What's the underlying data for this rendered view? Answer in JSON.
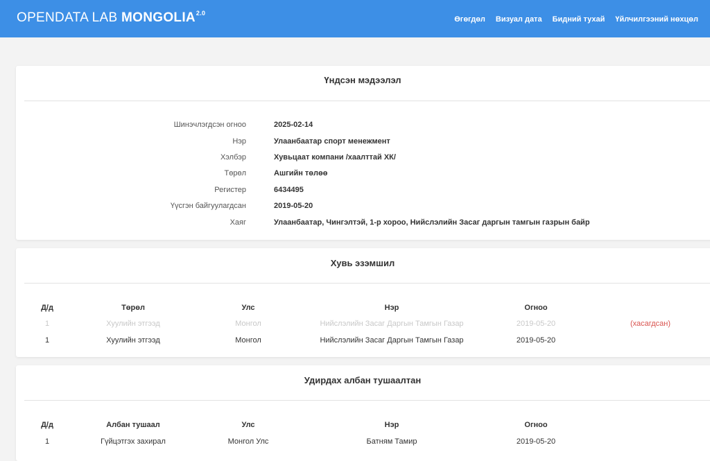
{
  "brand": {
    "light": "OPENDATA LAB ",
    "bold": "MONGOLIA",
    "version": "2.0"
  },
  "nav": [
    "Өгөгдөл",
    "Визуал дата",
    "Бидний тухай",
    "Үйлчилгээний нөхцөл"
  ],
  "basic_info": {
    "title": "Үндсэн мэдээлэл",
    "rows": [
      {
        "label": "Шинэчлэгдсэн огноо",
        "value": "2025-02-14"
      },
      {
        "label": "Нэр",
        "value": "Улаанбаатар спорт менежмент"
      },
      {
        "label": "Хэлбэр",
        "value": "Хувьцаат компани /хаалттай ХК/"
      },
      {
        "label": "Төрөл",
        "value": "Ашгийн төлөө"
      },
      {
        "label": "Регистер",
        "value": "6434495"
      },
      {
        "label": "Үүсгэн байгуулагдсан",
        "value": "2019-05-20"
      },
      {
        "label": "Хаяг",
        "value": "Улаанбаатар, Чингэлтэй, 1-р хороо, Нийслэлийн Засаг даргын тамгын газрын байр"
      }
    ]
  },
  "ownership": {
    "title": "Хувь эзэмшил",
    "headers": [
      "Д/д",
      "Төрөл",
      "Улс",
      "Нэр",
      "Огноо"
    ],
    "rows": [
      {
        "cells": [
          "1",
          "Хуулийн этгээд",
          "Монгол",
          "Нийслэлийн Засаг Даргын Тамгын Газар",
          "2019-05-20"
        ],
        "note": "(хасагдсан)",
        "removed": true
      },
      {
        "cells": [
          "1",
          "Хуулийн этгээд",
          "Монгол",
          "Нийслэлийн Засаг Даргын Тамгын Газар",
          "2019-05-20"
        ],
        "note": "",
        "removed": false
      }
    ]
  },
  "officials": {
    "title": "Удирдах албан тушаалтан",
    "headers": [
      "Д/д",
      "Албан тушаал",
      "Улс",
      "Нэр",
      "Огноо"
    ],
    "rows": [
      {
        "cells": [
          "1",
          "Гүйцэтгэх захирал",
          "Монгол Улс",
          "Батням Тамир",
          "2019-05-20"
        ]
      }
    ]
  },
  "colors": {
    "navbar": "#3d8fe6",
    "removed": "#d9534f",
    "faded_text": "#c8c8c8"
  }
}
